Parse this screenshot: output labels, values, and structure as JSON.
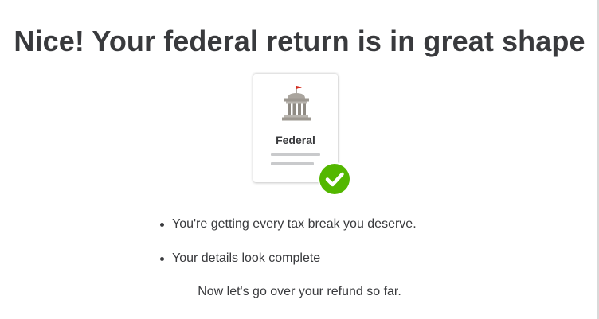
{
  "headline": "Nice! Your federal return is in great shape",
  "card": {
    "label": "Federal",
    "icon": "government-building-icon",
    "badge_icon": "checkmark-circle-icon"
  },
  "bullets": [
    {
      "text": "You're getting every tax break you deserve."
    },
    {
      "text": "Your details look complete"
    }
  ],
  "followup": "Now let's go over your refund so far.",
  "colors": {
    "text": "#393a3d",
    "success_green": "#53b700",
    "flag_red": "#d52b1e",
    "building_gray": "#9d9891",
    "line_gray": "#c9cacc"
  }
}
